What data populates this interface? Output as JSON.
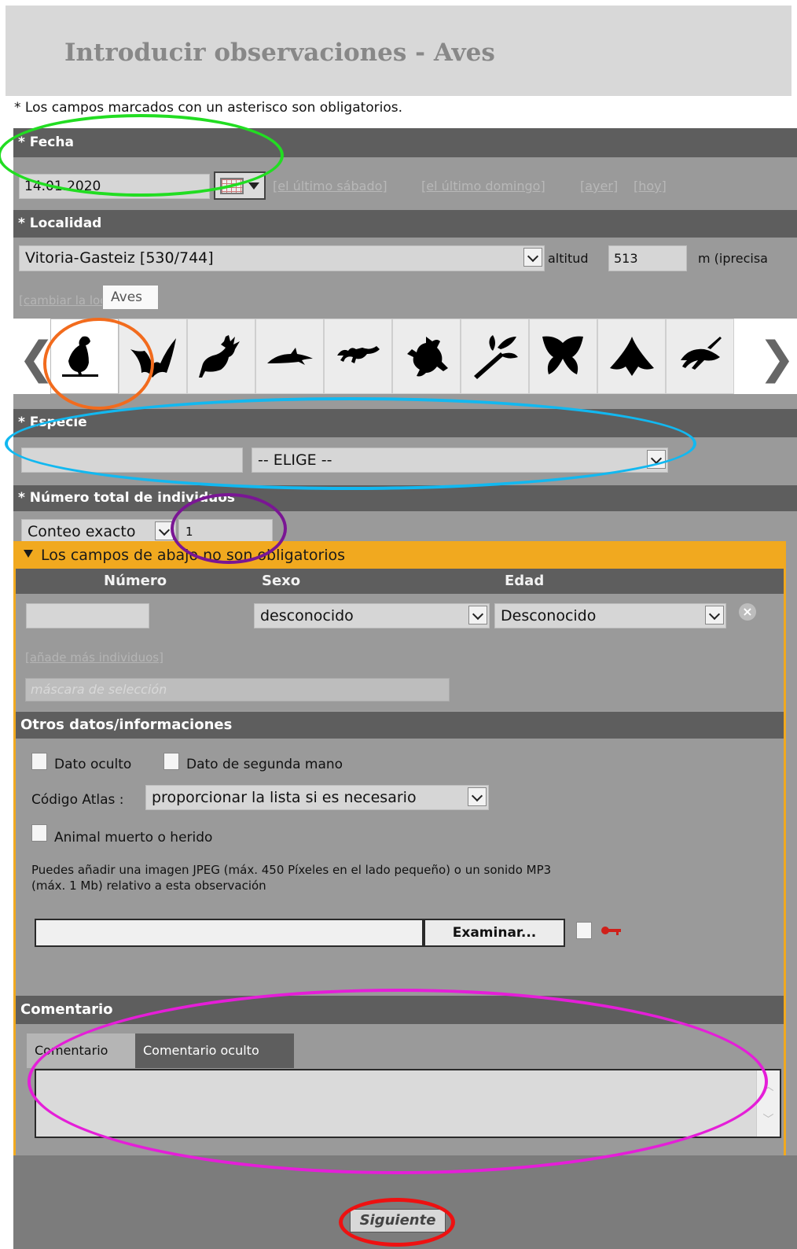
{
  "page_title": "Introducir observaciones - Aves",
  "required_note": "* Los campos marcados con un asterisco son obligatorios.",
  "fecha": {
    "label": "* Fecha",
    "value": "14.01.2020",
    "quick_links": [
      "[el último sábado]",
      "[el último domingo]",
      "[ayer]",
      "[hoy]"
    ]
  },
  "localidad": {
    "label": "* Localidad",
    "selected": "Vitoria-Gasteiz [530/744]",
    "altitud_label": "altitud",
    "altitud_value": "513",
    "unit_text": "m (iprecisa",
    "change_link": "[cambiar la localidad]"
  },
  "taxa": {
    "prev_arrow": "❮",
    "next_arrow": "❯",
    "tiles": [
      "bird-icon",
      "bat-icon",
      "deer-icon",
      "dolphin-icon",
      "lizard-icon",
      "frog-icon",
      "dragonfly-icon",
      "butterfly-icon",
      "moth-icon",
      "cricket-icon"
    ],
    "active": 0,
    "tooltip": "Aves"
  },
  "especie": {
    "label": "* Especie",
    "search_value": "",
    "selected": "-- ELIGE --"
  },
  "numero_total": {
    "label": "* Número total de individuos",
    "count_type": "Conteo exacto",
    "count_value": "1"
  },
  "optional": {
    "header": "Los campos de abajo no son obligatorios",
    "columns": [
      "Número",
      "Sexo",
      "Edad"
    ],
    "numero_value": "",
    "sexo": "desconocido",
    "edad": "Desconocido",
    "add_more_link": "[añade más individuos]",
    "mask_placeholder": "máscara de selección",
    "otros_label": "Otros datos/informaciones",
    "dato_oculto": "Dato oculto",
    "dato_segunda_mano": "Dato de segunda mano",
    "codigo_atlas_label": "Código Atlas :",
    "codigo_atlas_value": "proporcionar la lista si es necesario",
    "animal_muerto": "Animal muerto o herido",
    "upload_note_1": "Puedes añadir una imagen JPEG (máx. 450 Píxeles en el lado pequeño) o un sonido MP3",
    "upload_note_2": "(máx. 1 Mb) relativo a esta observación",
    "browse_button": "Examinar...",
    "comentario_label": "Comentario",
    "tabs": [
      "Comentario",
      "Comentario oculto"
    ]
  },
  "next_button": "Siguiente",
  "colors": {
    "dark_bar": "#5e5e5e",
    "panel": "#9a9a9a",
    "orange": "#f1a91f",
    "ring_green": "#22dd22",
    "ring_orange": "#f26b1d",
    "ring_cyan": "#12b8f0",
    "ring_purple": "#7a1694",
    "ring_magenta": "#e51ed8",
    "ring_red": "#ee1111"
  }
}
